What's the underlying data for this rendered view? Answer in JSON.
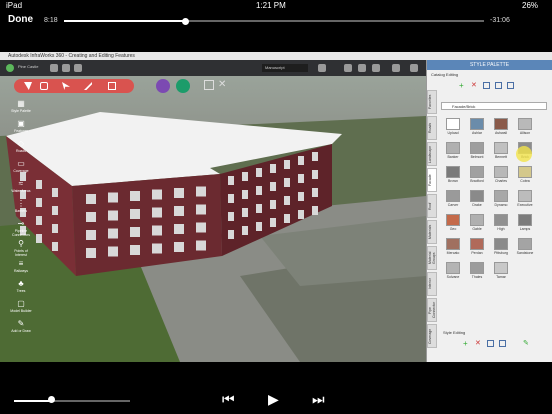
{
  "status": {
    "device": "iPad",
    "time": "1:21 PM",
    "battery": "26%"
  },
  "player": {
    "done_label": "Done",
    "elapsed": "8:18",
    "remaining": "-31:06",
    "progress_fraction": 0.29,
    "volume_fraction": 0.32
  },
  "app": {
    "window_title": "Autodesk InfraWorks 360 - Creating and Editing Features",
    "tab": "Pine Castle",
    "search_placeholder": "Manuscript"
  },
  "left_tools": [
    {
      "label": "Style Palette",
      "icon": "palette-icon"
    },
    {
      "label": "Features",
      "icon": "building-icon"
    },
    {
      "label": "Roads",
      "icon": "road-icon"
    },
    {
      "label": "Coverage",
      "icon": "area-icon"
    },
    {
      "label": "Water Areas",
      "icon": "water-icon"
    },
    {
      "label": "Barriers",
      "icon": "fence-icon"
    },
    {
      "label": "Pipeline Connectors",
      "icon": "pipe-icon"
    },
    {
      "label": "Points of Interest",
      "icon": "pin-icon"
    },
    {
      "label": "Railways",
      "icon": "rail-icon"
    },
    {
      "label": "Trees",
      "icon": "tree-icon"
    },
    {
      "label": "Model Builder",
      "icon": "cube-icon"
    },
    {
      "label": "Add or Draw",
      "icon": "pencil-icon"
    }
  ],
  "palette": {
    "title": "STYLE PALETTE",
    "catalog_label": "Catalog Editing",
    "dropdown_value": "Facade/Brick",
    "style_editing_label": "Style Editing",
    "tabs": [
      "Favorites",
      "Roads",
      "Landscape",
      "Facade",
      "Roof",
      "Materials",
      "Material Groups",
      "Interior",
      "Pipe Connector",
      "Coverage"
    ],
    "items": [
      "Upload",
      "Ashlar",
      "Ashwall",
      "Allison",
      "Banker",
      "Belmont",
      "Bennett",
      "Brick",
      "Brown",
      "Bradford",
      "Charles",
      "Cobra",
      "Carver",
      "Drake",
      "Dynamo",
      "Executive",
      "Geo",
      "Gable",
      "High",
      "Lamps",
      "Mercato",
      "Perdan",
      "Pittsburg",
      "Sandstone",
      "Solvane",
      "Thales",
      "Tamar"
    ],
    "item_colors": [
      "#ffffff",
      "#6b8caa",
      "#8a5a4a",
      "#b9b9b9",
      "#b0b0b0",
      "#9e9e9e",
      "#c0c0c0",
      "#8c8c8c",
      "#7a7a7a",
      "#a0a0a0",
      "#b8b8b8",
      "#d4c88c",
      "#9a9a9a",
      "#8a8a8a",
      "#a8a8a8",
      "#bcbcbc",
      "#c46a4a",
      "#b0b0b0",
      "#909090",
      "#7c7c7c",
      "#a07060",
      "#b06a5a",
      "#8a8a8a",
      "#a4a4a4",
      "#b4b4b4",
      "#9c9c9c",
      "#c8c8c8"
    ]
  },
  "colors": {
    "toolbar_red": "#d9534f",
    "panel_header": "#5b86b8",
    "highlight": "#f3e34a"
  }
}
